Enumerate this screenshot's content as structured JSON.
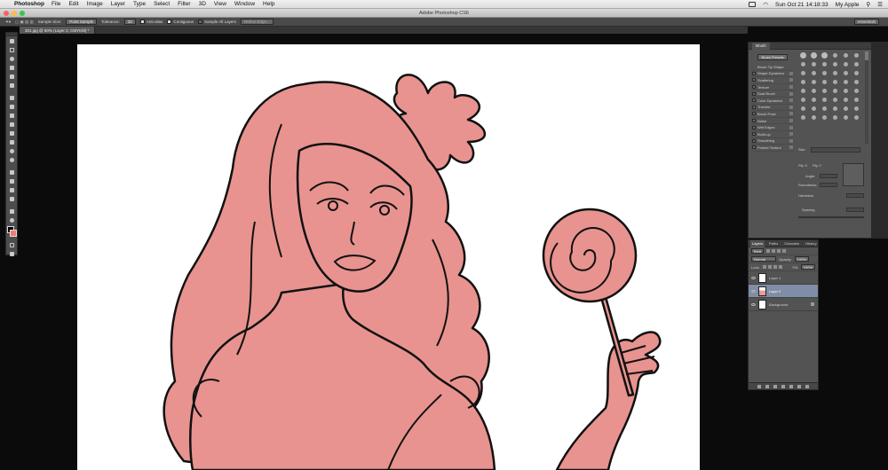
{
  "menubar": {
    "app_name": "Photoshop",
    "menus": [
      "File",
      "Edit",
      "Image",
      "Layer",
      "Type",
      "Select",
      "Filter",
      "3D",
      "View",
      "Window",
      "Help"
    ],
    "datetime": "Sun Oct 21  14:18:33",
    "user": "My Apple"
  },
  "window": {
    "title": "Adobe Photoshop CS6"
  },
  "options": {
    "sample_size_label": "Sample Size:",
    "sample_size_value": "Point Sample",
    "tolerance_label": "Tolerance:",
    "tolerance_value": "32",
    "anti_alias": "Anti-alias",
    "contiguous": "Contiguous",
    "sample_all_layers": "Sample All Layers",
    "refine_edge": "Refine Edge...",
    "workspace": "essentials"
  },
  "document": {
    "tab_label": "301.jpg @ 50% (Layer 2, CMYK/8) *"
  },
  "brush_panel": {
    "tab": "Brush",
    "presets_button": "Brush Presets",
    "options": [
      "Brush Tip Shape",
      "Shape Dynamics",
      "Scattering",
      "Texture",
      "Dual Brush",
      "Color Dynamics",
      "Transfer",
      "Brush Pose",
      "Noise",
      "Wet Edges",
      "Build-up",
      "Smoothing",
      "Protect Texture"
    ],
    "size_label": "Size",
    "flip_x": "Flip X",
    "flip_y": "Flip Y",
    "angle_label": "Angle:",
    "roundness_label": "Roundness:",
    "hardness_label": "Hardness",
    "spacing_label": "Spacing"
  },
  "layers_panel": {
    "tabs": [
      "Layers",
      "Paths",
      "Channels",
      "History"
    ],
    "kind_label": "Kind",
    "blend_mode": "Normal",
    "opacity_label": "Opacity:",
    "opacity_value": "100%",
    "lock_label": "Lock:",
    "fill_label": "Fill:",
    "fill_value": "100%",
    "layers": [
      {
        "name": "Layer 1"
      },
      {
        "name": "Layer 2"
      },
      {
        "name": "Background"
      }
    ]
  },
  "colors": {
    "foreground": "#000000",
    "background": "#f07a75",
    "fill_pink": "#e8938f"
  }
}
